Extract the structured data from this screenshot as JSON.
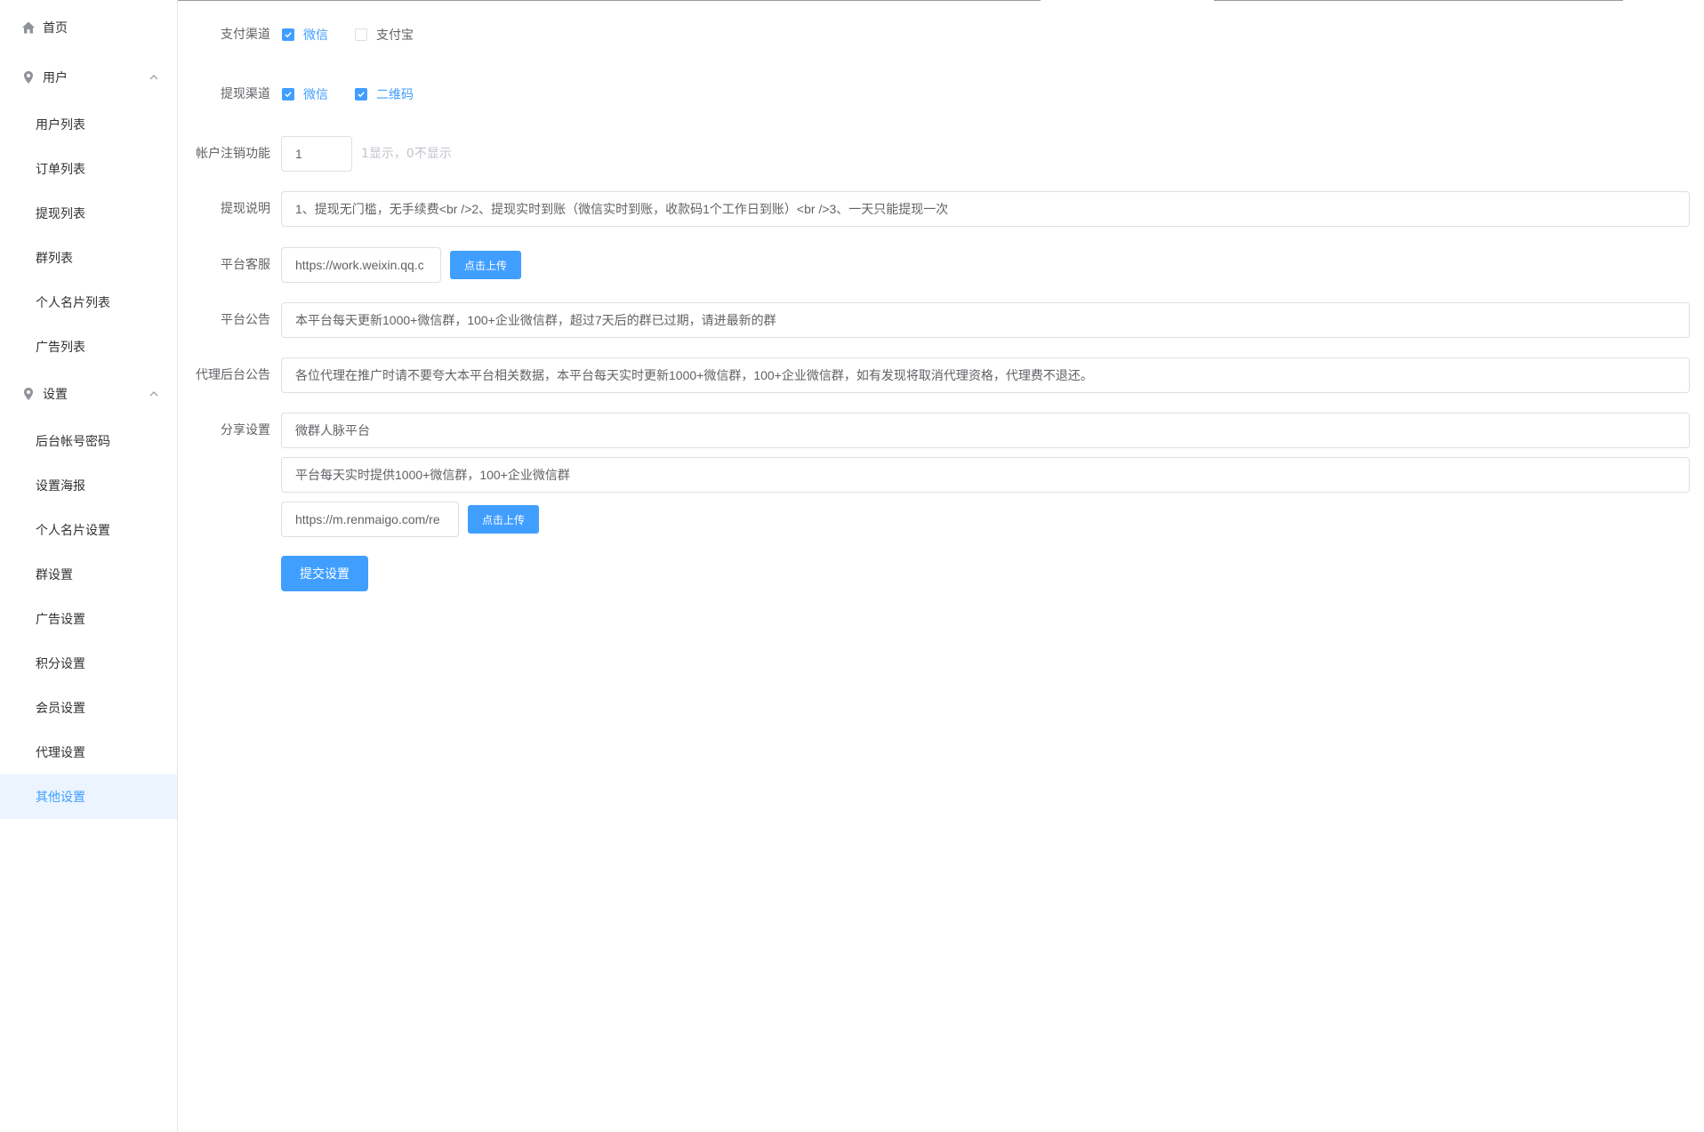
{
  "sidebar": {
    "home": "首页",
    "users_group": "用户",
    "users_items": [
      "用户列表",
      "订单列表",
      "提现列表",
      "群列表",
      "个人名片列表",
      "广告列表"
    ],
    "settings_group": "设置",
    "settings_items": [
      "后台帐号密码",
      "设置海报",
      "个人名片设置",
      "群设置",
      "广告设置",
      "积分设置",
      "会员设置",
      "代理设置",
      "其他设置"
    ],
    "active": "其他设置"
  },
  "form": {
    "pay_channel": {
      "label": "支付渠道",
      "options": [
        {
          "label": "微信",
          "checked": true
        },
        {
          "label": "支付宝",
          "checked": false
        }
      ]
    },
    "withdraw_channel": {
      "label": "提现渠道",
      "options": [
        {
          "label": "微信",
          "checked": true
        },
        {
          "label": "二维码",
          "checked": true
        }
      ]
    },
    "account_cancel": {
      "label": "帐户注销功能",
      "value": "1",
      "hint": "1显示，0不显示"
    },
    "withdraw_desc": {
      "label": "提现说明",
      "value": "1、提现无门槛，无手续费<br />2、提现实时到账（微信实时到账，收款码1个工作日到账）<br />3、一天只能提现一次"
    },
    "customer_service": {
      "label": "平台客服",
      "value": "https://work.weixin.qq.c",
      "upload_label": "点击上传"
    },
    "platform_notice": {
      "label": "平台公告",
      "value": "本平台每天更新1000+微信群，100+企业微信群，超过7天后的群已过期，请进最新的群"
    },
    "agent_notice": {
      "label": "代理后台公告",
      "value": "各位代理在推广时请不要夸大本平台相关数据，本平台每天实时更新1000+微信群，100+企业微信群，如有发现将取消代理资格，代理费不退还。"
    },
    "share": {
      "label": "分享设置",
      "title": "微群人脉平台",
      "desc": "平台每天实时提供1000+微信群，100+企业微信群",
      "image_url": "https://m.renmaigo.com/re",
      "upload_label": "点击上传"
    },
    "submit_label": "提交设置"
  },
  "colors": {
    "accent": "#409eff",
    "active_bg": "#ecf5ff",
    "border": "#dcdfe6",
    "hint": "#c0c4cc"
  }
}
